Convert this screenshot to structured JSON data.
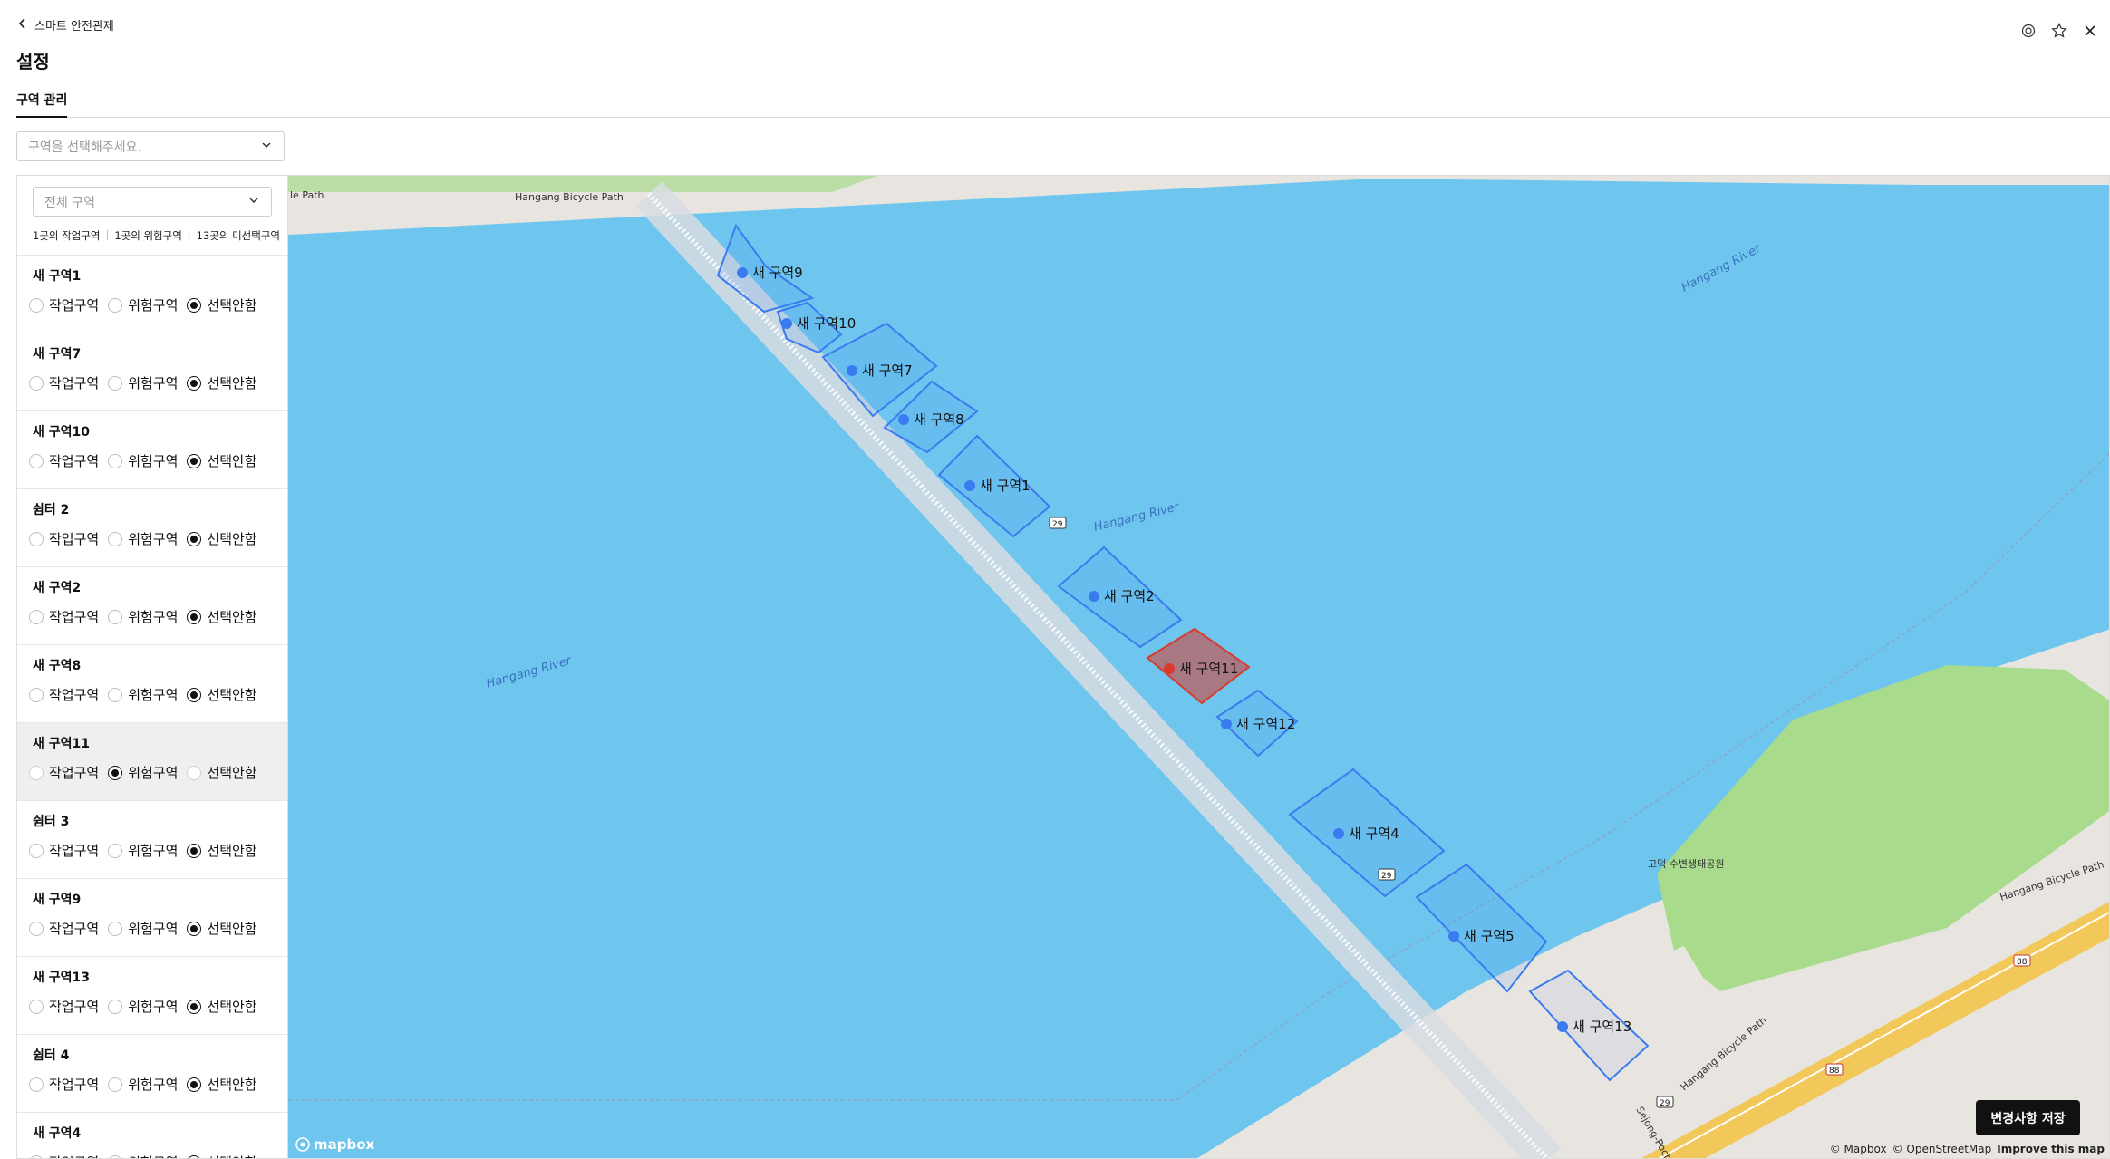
{
  "breadcrumb": {
    "label": "스마트 안전관제"
  },
  "page": {
    "title": "설정"
  },
  "tabs": [
    {
      "label": "구역 관리"
    }
  ],
  "zone_select": {
    "placeholder": "구역을 선택해주세요."
  },
  "filter_select": {
    "value": "전체 구역"
  },
  "summary": {
    "work": "1곳의 작업구역",
    "danger": "1곳의 위험구역",
    "unselected": "13곳의 미선택구역"
  },
  "radio_labels": {
    "work": "작업구역",
    "danger": "위험구역",
    "none": "선택안함"
  },
  "zones": [
    {
      "name": "새 구역1",
      "selected": "none"
    },
    {
      "name": "새 구역7",
      "selected": "none"
    },
    {
      "name": "새 구역10",
      "selected": "none"
    },
    {
      "name": "쉼터 2",
      "selected": "none"
    },
    {
      "name": "새 구역2",
      "selected": "none"
    },
    {
      "name": "새 구역8",
      "selected": "none"
    },
    {
      "name": "새 구역11",
      "selected": "danger",
      "active": true
    },
    {
      "name": "쉼터 3",
      "selected": "none"
    },
    {
      "name": "새 구역9",
      "selected": "none"
    },
    {
      "name": "새 구역13",
      "selected": "none"
    },
    {
      "name": "쉼터 4",
      "selected": "none"
    },
    {
      "name": "새 구역4",
      "selected": "none"
    }
  ],
  "map": {
    "zone_labels": {
      "z9": "새 구역9",
      "z10": "새 구역10",
      "z7": "새 구역7",
      "z8": "새 구역8",
      "z1": "새 구역1",
      "z2": "새 구역2",
      "z11": "새 구역11",
      "z12": "새 구역12",
      "z4": "새 구역4",
      "z5": "새 구역5",
      "z13": "새 구역13"
    },
    "labels": {
      "river1": "Hangang River",
      "river2": "Hangang River",
      "river3": "Hangang River",
      "path1": "le Path",
      "path2": "Hangang Bicycle Path",
      "path3": "Hangang Bicycle Path",
      "path4": "Hangang Bicycle Path",
      "park": "고덕 수변생태공원",
      "road": "Sejong-Pocheon",
      "shield29a": "29",
      "shield29b": "29",
      "shield29c": "29",
      "shield88a": "88",
      "shield88b": "88"
    },
    "colors": {
      "water": "#6ec6ee",
      "land": "#e8e5e0",
      "park": "#a8dc8c",
      "zone": "#3a7bf0",
      "danger": "#d93a2b",
      "road": "#f2c85a"
    }
  },
  "save_button": {
    "label": "변경사항 저장"
  },
  "attribution": {
    "mapbox": "© Mapbox",
    "osm": "© OpenStreetMap",
    "improve": "Improve this map"
  },
  "mapbox_logo": "mapbox"
}
